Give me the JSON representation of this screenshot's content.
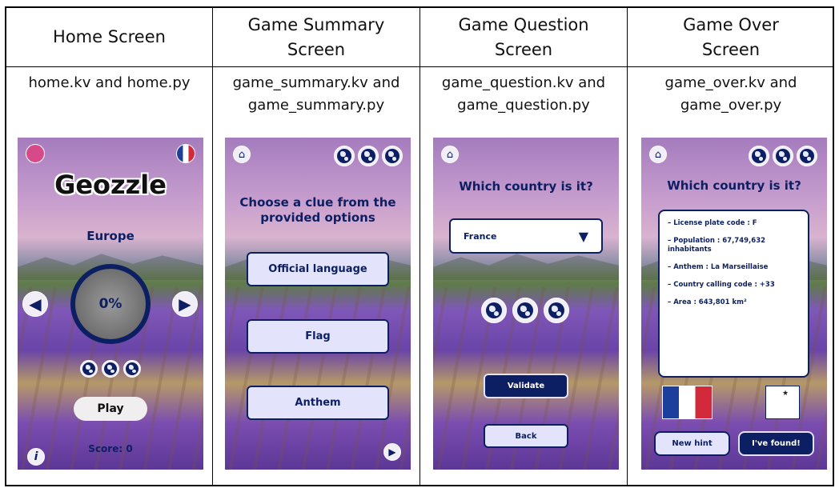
{
  "columns": [
    {
      "heading": "Home Screen",
      "files": "home.kv and home.py"
    },
    {
      "heading": "Game Summary Screen",
      "files": "game_summary.kv and game_summary.py"
    },
    {
      "heading": "Game Question Screen",
      "files": "game_question.kv and game_question.py"
    },
    {
      "heading": "Game Over Screen",
      "files": "game_over.kv and game_over.py"
    }
  ],
  "home": {
    "app_title": "Geozzle",
    "region": "Europe",
    "progress_text": "0%",
    "play_label": "Play",
    "score_text": "Score: 0",
    "info_glyph": "i"
  },
  "summary": {
    "prompt": "Choose a clue from the provided options",
    "options": [
      "Official language",
      "Flag",
      "Anthem"
    ]
  },
  "question": {
    "prompt": "Which country is it?",
    "selected_country": "France",
    "validate_label": "Validate",
    "back_label": "Back"
  },
  "over": {
    "prompt": "Which country is it?",
    "clues": [
      "– License plate code : F",
      "– Population : 67,749,632 inhabitants",
      "– Anthem : La Marseillaise",
      "– Country calling code : +33",
      "– Area : 643,801 km²"
    ],
    "new_hint_label": "New hint",
    "found_label": "I've found!"
  },
  "colors": {
    "navy": "#0c1f63",
    "button_fill": "#e3e3fb"
  }
}
